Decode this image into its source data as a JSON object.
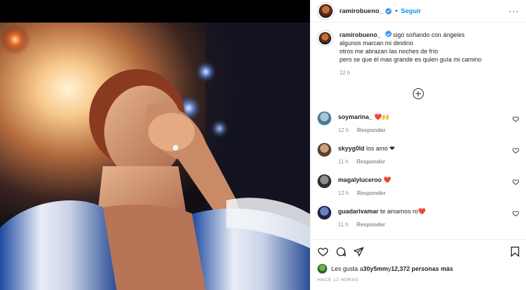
{
  "post": {
    "username": "ramirobueno_",
    "follow_label": "Seguir",
    "separator": "•",
    "more_label": "···"
  },
  "caption": {
    "username": "ramirobueno_",
    "lines": [
      "sigo soñando con ángeles",
      "algunos marcan mi destino",
      "otros me abrazan las noches de frío",
      "pero se que él mas grande es quien guía mi camino"
    ],
    "time": "12 h"
  },
  "comments": [
    {
      "username": "soymarina_",
      "text": "❤️🙌",
      "time": "12 h",
      "reply": "Responder",
      "avatar_color": "#7aa0b8"
    },
    {
      "username": "skyyg0ld",
      "text": "los amo ❤",
      "time": "11 h",
      "reply": "Responder",
      "avatar_color": "#8a6a4e"
    },
    {
      "username": "magalyluceroo",
      "text": "❤️",
      "time": "12 h",
      "reply": "Responder",
      "avatar_color": "#5b5b5b"
    },
    {
      "username": "guadarivamar",
      "text": "te amamos ro❤️",
      "time": "11 h",
      "reply": "Responder",
      "avatar_color": "#2f3b63"
    }
  ],
  "likes": {
    "prefix": "Les gusta a ",
    "user": "30y5mm",
    "middle": " y ",
    "count": "12,372 personas más"
  },
  "posted": "HACE 12 HORAS",
  "icons": [
    "heart-icon",
    "comment-icon",
    "share-icon",
    "bookmark-icon",
    "plus-circle-icon",
    "verified-badge-icon",
    "more-options-icon"
  ],
  "colors": {
    "accent": "#0095f6",
    "verified": "#3897f0",
    "muted": "#8e8e8e",
    "text": "#262626"
  }
}
